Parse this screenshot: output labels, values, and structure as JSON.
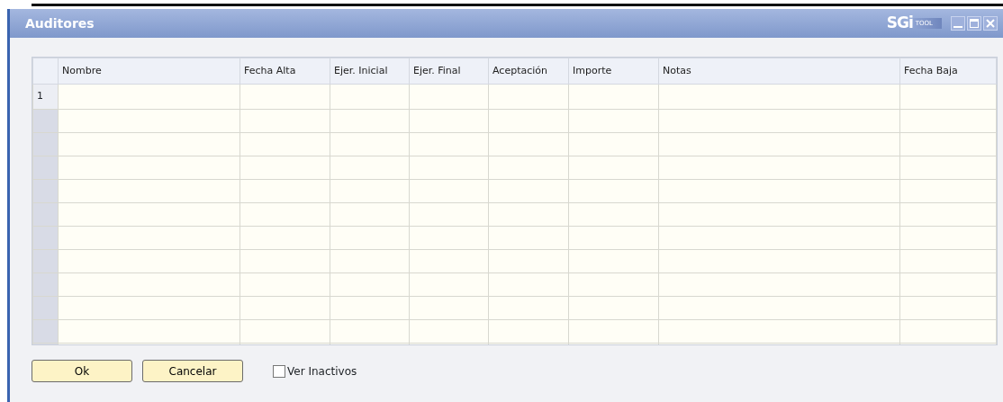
{
  "window": {
    "title": "Auditores",
    "logo": {
      "brand": "SGi",
      "tag": "TOOL"
    }
  },
  "table": {
    "columns": [
      "Nombre",
      "Fecha Alta",
      "Ejer. Inicial",
      "Ejer. Final",
      "Aceptación",
      "Importe",
      "Notas",
      "Fecha Baja"
    ],
    "rows": [
      {
        "number": "1"
      }
    ]
  },
  "buttons": [
    {
      "label": "Ok"
    },
    {
      "label": "Cancelar"
    }
  ],
  "checkbox": {
    "label": "Ver Inactivos",
    "checked": false
  }
}
